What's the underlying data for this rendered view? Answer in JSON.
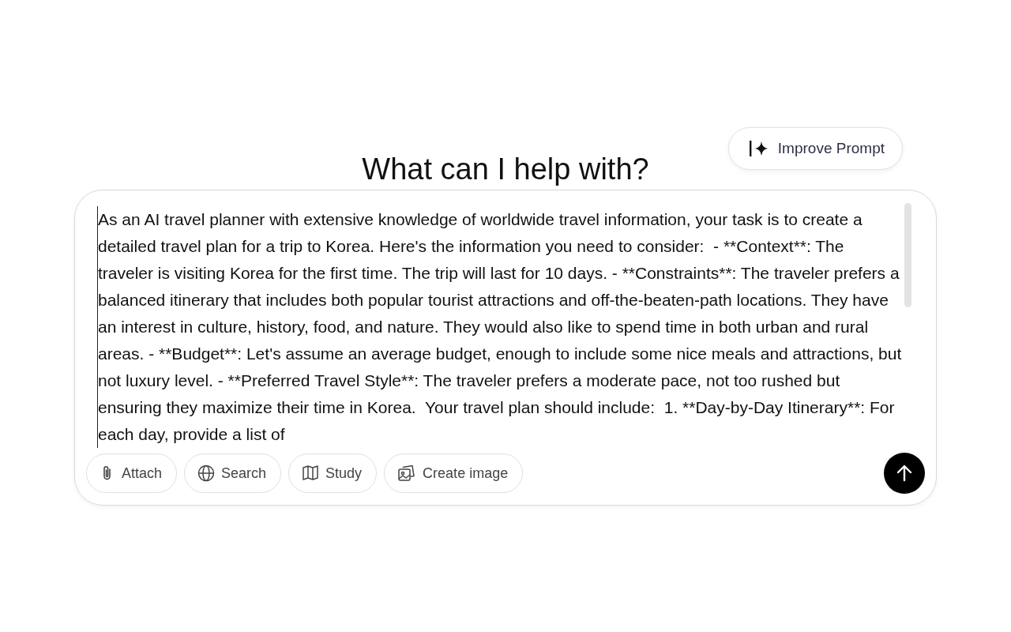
{
  "improve_button": {
    "label": "Improve Prompt"
  },
  "heading": "What can I help with?",
  "composer": {
    "value": "As an AI travel planner with extensive knowledge of worldwide travel information, your task is to create a detailed travel plan for a trip to Korea. Here's the information you need to consider:  - **Context**: The traveler is visiting Korea for the first time. The trip will last for 10 days. - **Constraints**: The traveler prefers a balanced itinerary that includes both popular tourist attractions and off-the-beaten-path locations. They have an interest in culture, history, food, and nature. They would also like to spend time in both urban and rural areas. - **Budget**: Let's assume an average budget, enough to include some nice meals and attractions, but not luxury level. - **Preferred Travel Style**: The traveler prefers a moderate pace, not too rushed but ensuring they maximize their time in Korea.  Your travel plan should include:  1. **Day-by-Day Itinerary**: For each day, provide a list of",
    "tools": [
      {
        "kind": "attach",
        "label": "Attach"
      },
      {
        "kind": "search",
        "label": "Search"
      },
      {
        "kind": "study",
        "label": "Study"
      },
      {
        "kind": "image",
        "label": "Create image"
      }
    ]
  }
}
